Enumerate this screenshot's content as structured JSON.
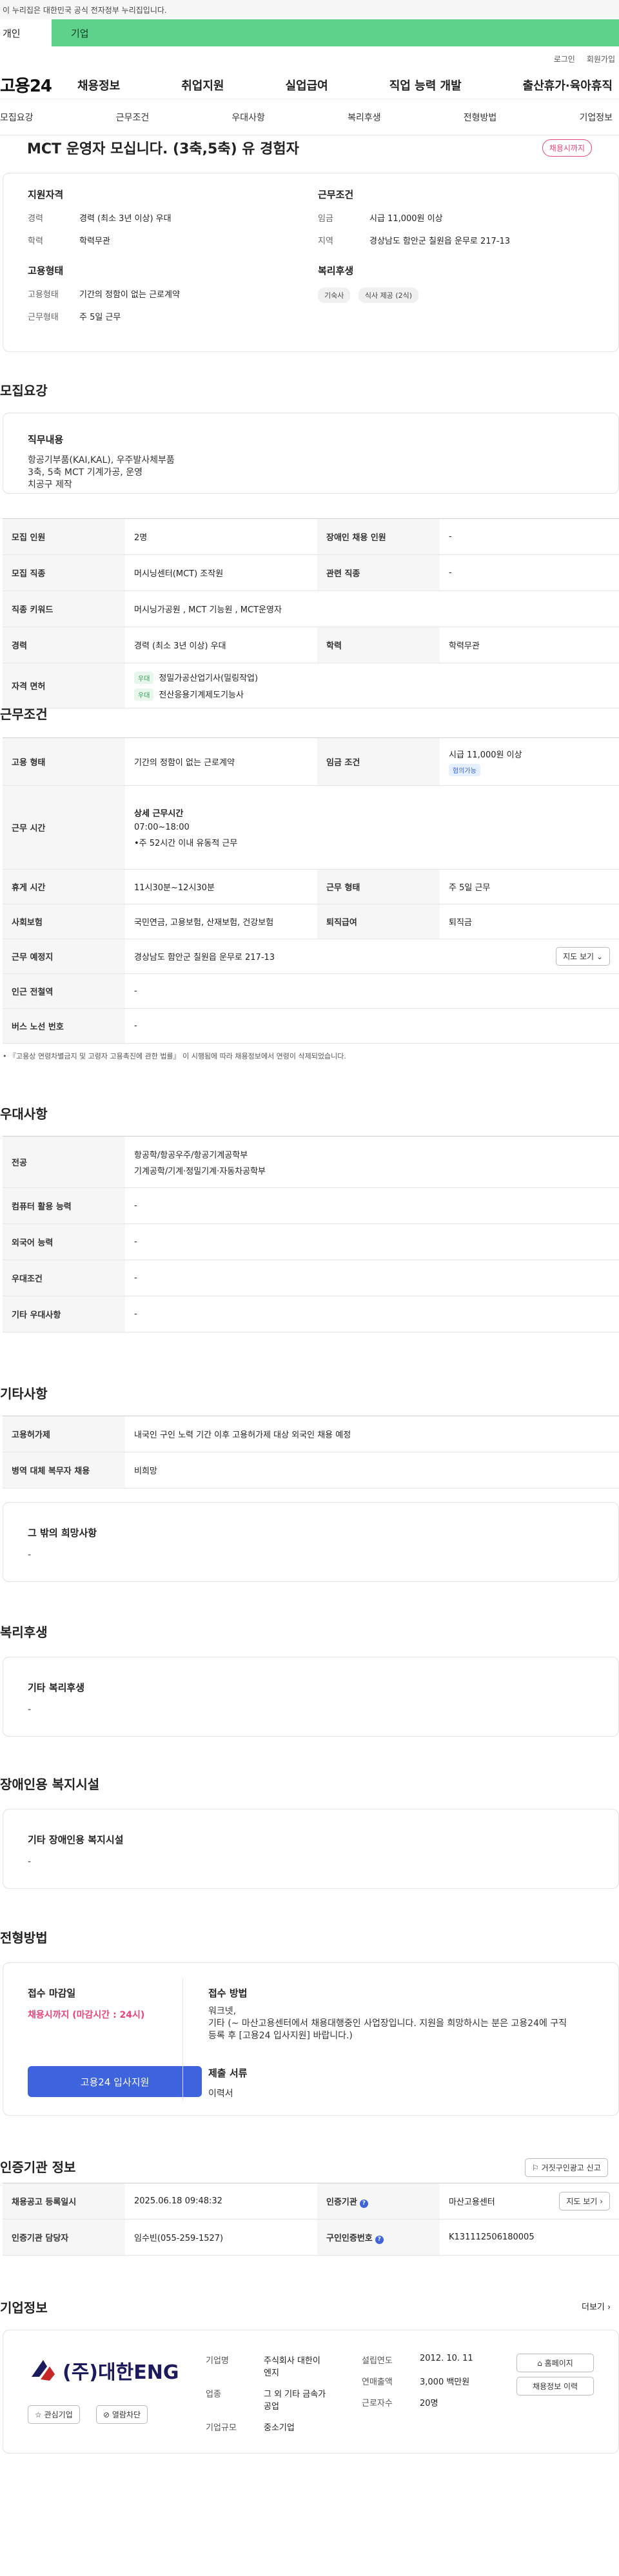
{
  "gov_banner": "이 누리집은 대한민국 공식 전자정부 누리집입니다.",
  "tabs": {
    "personal": "개인",
    "company": "기업"
  },
  "util": {
    "login": "로그인",
    "signup": "회원가입"
  },
  "logo": "고용24",
  "gnb": [
    "채용정보",
    "취업지원",
    "실업급여",
    "직업 능력 개발",
    "출산휴가·육아휴직"
  ],
  "subnav": [
    "모집요강",
    "근무조건",
    "우대사항",
    "복리후생",
    "전형방법",
    "기업정보"
  ],
  "job": {
    "title": "MCT 운영자 모십니다. (3축,5축) 유 경험자",
    "status": "채용시까지"
  },
  "summary": {
    "qualification": {
      "heading": "지원자격",
      "career_label": "경력",
      "career": "경력 (최소 3년 이상) 우대",
      "edu_label": "학력",
      "edu": "학력무관"
    },
    "conditions": {
      "heading": "근무조건",
      "wage_label": "임금",
      "wage": "시급 11,000원 이상",
      "region_label": "지역",
      "region": "경상남도 함안군 칠원읍 운무로 217-13"
    },
    "employment": {
      "heading": "고용형태",
      "type_label": "고용형태",
      "type": "기간의 정함이 없는 근로계약",
      "hours_label": "근무형태",
      "hours": "주 5일 근무"
    },
    "welfare": {
      "heading": "복리후생",
      "pills": [
        "기숙사",
        "식사 제공 (2식)"
      ]
    }
  },
  "recruit": {
    "title": "모집요강",
    "duty_label": "직무내용",
    "duty_lines": [
      "항공기부품(KAI,KAL), 우주발사체부품",
      "3축, 5축 MCT 기계가공, 운영",
      "치공구 제작"
    ],
    "rows": {
      "headcount_label": "모집 인원",
      "headcount": "2명",
      "disabled_label": "장애인 채용 인원",
      "disabled": "-",
      "job_label": "모집 직종",
      "job": "머시닝센터(MCT) 조작원",
      "related_label": "관련 직종",
      "related": "-",
      "keyword_label": "직종 키워드",
      "keyword": "머시닝가공원 , MCT 기능원 , MCT운영자",
      "career_label": "경력",
      "career": "경력 (최소 3년 이상) 우대",
      "edu_label": "학력",
      "edu": "학력무관",
      "license_label": "자격 면허",
      "licenses": [
        {
          "tag": "우대",
          "name": "정밀가공산업기사(밀링작업)"
        },
        {
          "tag": "우대",
          "name": "전산응용기계제도기능사"
        }
      ]
    }
  },
  "conditions": {
    "title": "근무조건",
    "type_label": "고용 형태",
    "type": "기간의 정함이 없는 근로계약",
    "wage_label": "임금 조건",
    "wage": "시급 11,000원 이상",
    "wage_tag": "협의가능",
    "time_label": "근무 시간",
    "time_head": "상세 근무시간",
    "time_range": "07:00~18:00",
    "time_note": "•주 52시간 이내 유동적 근무",
    "rest_label": "휴게 시간",
    "rest": "11시30분~12시30분",
    "form_label": "근무 형태",
    "form": "주 5일 근무",
    "insurance_label": "사회보험",
    "insurance": "국민연금, 고용보험, 산재보험, 건강보험",
    "severance_label": "퇴직급여",
    "severance": "퇴직금",
    "place_label": "근무 예정지",
    "place": "경상남도 함안군 칠원읍 운무로 217-13",
    "map_btn": "지도 보기",
    "station_label": "인근 전철역",
    "station": "-",
    "bus_label": "버스 노선 번호",
    "bus": "-",
    "note": "• 『고용상 연령차별금지 및 고령자 고용촉진에 관한 법률』 이 시행됨에 따라 채용정보에서 연령이 삭제되었습니다."
  },
  "prefer": {
    "title": "우대사항",
    "major_label": "전공",
    "major_lines": [
      "항공학/항공우주/항공기계공학부",
      "기계공학/기계·정밀기계·자동차공학부"
    ],
    "pc_label": "컴퓨터 활용 능력",
    "pc": "-",
    "lang_label": "외국어 능력",
    "lang": "-",
    "cond_label": "우대조건",
    "cond": "-",
    "etc_label": "기타 우대사항",
    "etc": "-"
  },
  "other": {
    "title": "기타사항",
    "foreign_label": "고용허가제",
    "foreign": "내국인 구인 노력 기간 이후 고용허가제 대상 외국인 채용 예정",
    "military_label": "병역 대체 복무자 채용",
    "military": "비희망",
    "etc_label": "그 밖의 희망사항",
    "etc": "-"
  },
  "welfare": {
    "title": "복리후생",
    "label": "기타 복리후생",
    "value": "-"
  },
  "disabled_fac": {
    "title": "장애인용 복지시설",
    "label": "기타 장애인용 복지시설",
    "value": "-"
  },
  "selection": {
    "title": "전형방법",
    "deadline_label": "접수 마감일",
    "deadline": "채용시까지 (마감시간 : 24시)",
    "apply_btn": "고용24 입사지원",
    "method_label": "접수 방법",
    "method_lines": [
      "워크넷,",
      "기타 (~ 마산고용센터에서 채용대행중인 사업장입니다. 지원을 희망하시는 분은 고용24에 구직",
      "등록 후 [고용24 입사지원] 바랍니다.)"
    ],
    "docs_label": "제출 서류",
    "docs": "이력서"
  },
  "cert": {
    "title": "인증기관 정보",
    "report_btn": "거짓구인광고 신고",
    "reg_label": "채용공고 등록일시",
    "reg": "2025.06.18 09:48:32",
    "agency_label": "인증기관",
    "agency": "마산고용센터",
    "map_btn": "지도 보기",
    "manager_label": "인증기관 담당자",
    "manager": "임수빈(055-259-1527)",
    "no_label": "구인인증번호",
    "no": "K131112506180005"
  },
  "company": {
    "title": "기업정보",
    "more": "더보기",
    "logo_text": "(주)대한ENG",
    "fav_btn": "관심기업",
    "block_btn": "열람차단",
    "name_label": "기업명",
    "name_lines": [
      "주식회사 대한이",
      "엔지"
    ],
    "industry_label": "업종",
    "industry_lines": [
      "그 외 기타 금속가",
      "공업"
    ],
    "size_label": "기업규모",
    "size": "중소기업",
    "founded_label": "설립연도",
    "founded": "2012. 10. 11",
    "sales_label": "연매출액",
    "sales": "3,000 백만원",
    "employees_label": "근로자수",
    "employees": "20명",
    "homepage_btn": "홈페이지",
    "history_btn": "채용정보 이력"
  }
}
